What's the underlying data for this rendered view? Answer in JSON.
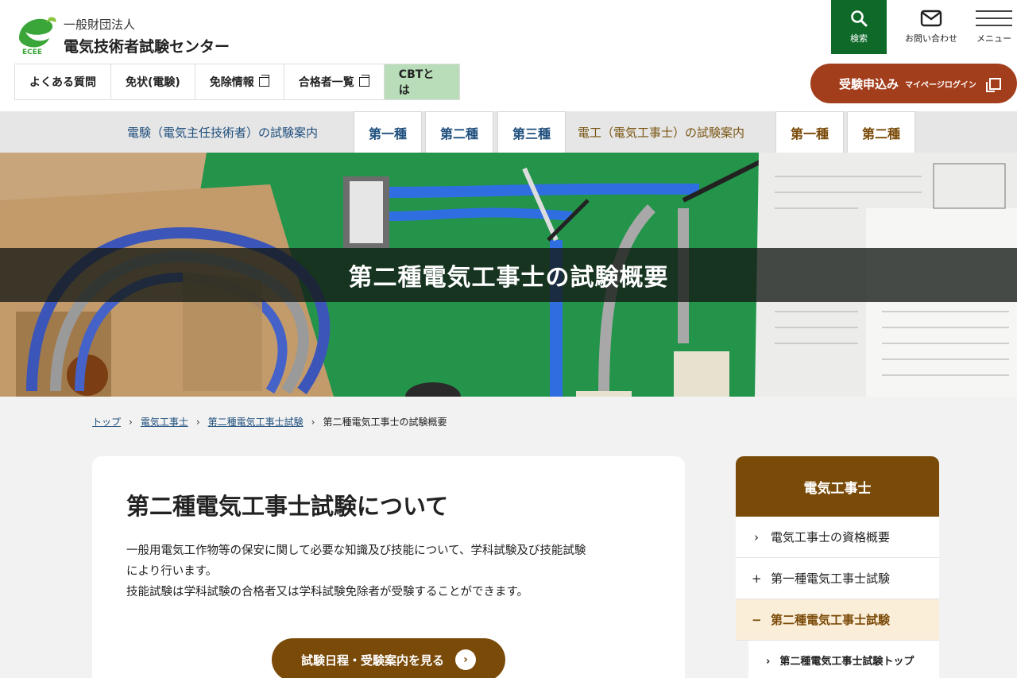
{
  "header": {
    "org_small": "一般財団法人",
    "org_name": "電気技術者試験センター",
    "logo_text": "ECEE",
    "nav": [
      {
        "label": "よくある質問",
        "external": false
      },
      {
        "label": "免状(電験)",
        "external": false
      },
      {
        "label": "免除情報",
        "external": true
      },
      {
        "label": "合格者一覧",
        "external": true
      },
      {
        "label": "CBTとは",
        "external": false
      }
    ],
    "search_label": "検索",
    "contact_label": "お問い合わせ",
    "menu_label": "メニュー",
    "apply_label": "受験申込み",
    "apply_sub": "マイページログイン"
  },
  "category_bar": {
    "denken_lead": "電験（電気主任技術者）の試験案内",
    "denken_tabs": [
      "第一種",
      "第二種",
      "第三種"
    ],
    "denko_lead": "電工（電気工事士）の試験案内",
    "denko_tabs": [
      "第一種",
      "第二種"
    ]
  },
  "hero": {
    "title": "第二種電気工事士の試験概要"
  },
  "breadcrumb": [
    {
      "label": "トップ",
      "link": true
    },
    {
      "label": "電気工事士",
      "link": true
    },
    {
      "label": "第二種電気工事士試験",
      "link": true
    },
    {
      "label": "第二種電気工事士の試験概要",
      "link": false
    }
  ],
  "main": {
    "heading": "第二種電気工事士試験について",
    "desc_line1": "一般用電気工作物等の保安に関して必要な知識及び技能について、学科試験及び技能試験",
    "desc_line2": "により行います。",
    "desc_line3": "技能試験は学科試験の合格者又は学科試験免除者が受験することができます。",
    "button_label": "試験日程・受験案内を見る"
  },
  "sidebar": {
    "title": "電気工事士",
    "items": [
      {
        "marker": "›",
        "label": "電気工事士の資格概要"
      },
      {
        "marker": "+",
        "label": "第一種電気工事士試験"
      },
      {
        "marker": "−",
        "label": "第二種電気工事士試験"
      }
    ],
    "sub_marker": "›",
    "sub_label": "第二種電気工事士試験トップ"
  },
  "colors": {
    "brand_green": "#0f6a2a",
    "brown": "#7a4a08",
    "apply_red": "#a33e1d",
    "denken_blue": "#1f4f7d",
    "cbt_green": "#b9ddb9"
  }
}
